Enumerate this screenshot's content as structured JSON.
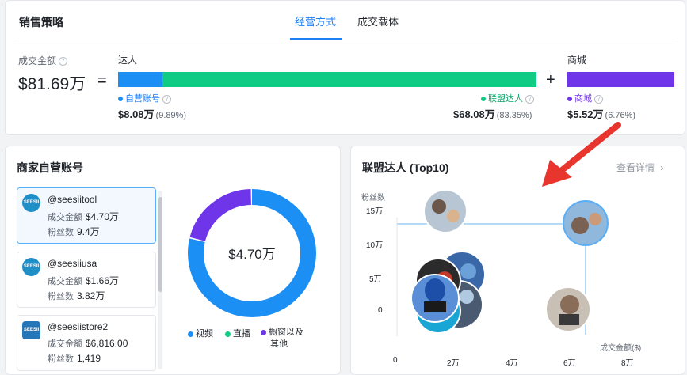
{
  "top": {
    "title": "销售策略",
    "tabs": [
      {
        "label": "经营方式",
        "active": true
      },
      {
        "label": "成交载体",
        "active": false
      }
    ],
    "total_label": "成交金额",
    "total_value": "$81.69万",
    "equals": "=",
    "plus": "+",
    "daren": {
      "label": "达人",
      "self": {
        "label": "自营账号",
        "value": "$8.08万",
        "pct": "(9.89%)",
        "share": 9.89,
        "color": "#1c8ff4"
      },
      "alliance": {
        "label": "联盟达人",
        "value": "$68.08万",
        "pct": "(83.35%)",
        "share": 83.35,
        "color": "#0fcb83"
      }
    },
    "mall": {
      "label": "商城",
      "sub_label": "商城",
      "value": "$5.52万",
      "pct": "(6.76%)",
      "color": "#6f35e8"
    }
  },
  "self_accounts": {
    "title": "商家自营账号",
    "amount_label": "成交金额",
    "fans_label": "粉丝数",
    "accounts": [
      {
        "logo": "SEESII",
        "name": "@seesiitool",
        "amount": "$4.70万",
        "fans": "9.4万",
        "selected": true
      },
      {
        "logo": "SEESII",
        "name": "@seesiiusa",
        "amount": "$1.66万",
        "fans": "3.82万",
        "selected": false
      },
      {
        "logo": "SEESII",
        "name": "@seesiistore2",
        "amount": "$6,816.00",
        "fans": "1,419",
        "selected": false
      }
    ],
    "donut_center": "$4.70万",
    "donut": [
      {
        "name": "视频",
        "value": 79,
        "color": "#1c8ff4"
      },
      {
        "name": "直播",
        "value": 0,
        "color": "#0fcb83"
      },
      {
        "name": "橱窗以及其他",
        "value": 21,
        "color": "#6f35e8"
      }
    ],
    "legend_line1": "橱窗以及",
    "legend_line2": "其他"
  },
  "alliance": {
    "title": "联盟达人 (Top10)",
    "more_label": "查看详情",
    "y_title": "粉丝数",
    "x_title": "成交金额($)",
    "y_ticks": [
      "15万",
      "10万",
      "5万",
      "0"
    ],
    "x_ticks": [
      "0",
      "2万",
      "4万",
      "6万",
      "8万"
    ]
  }
}
